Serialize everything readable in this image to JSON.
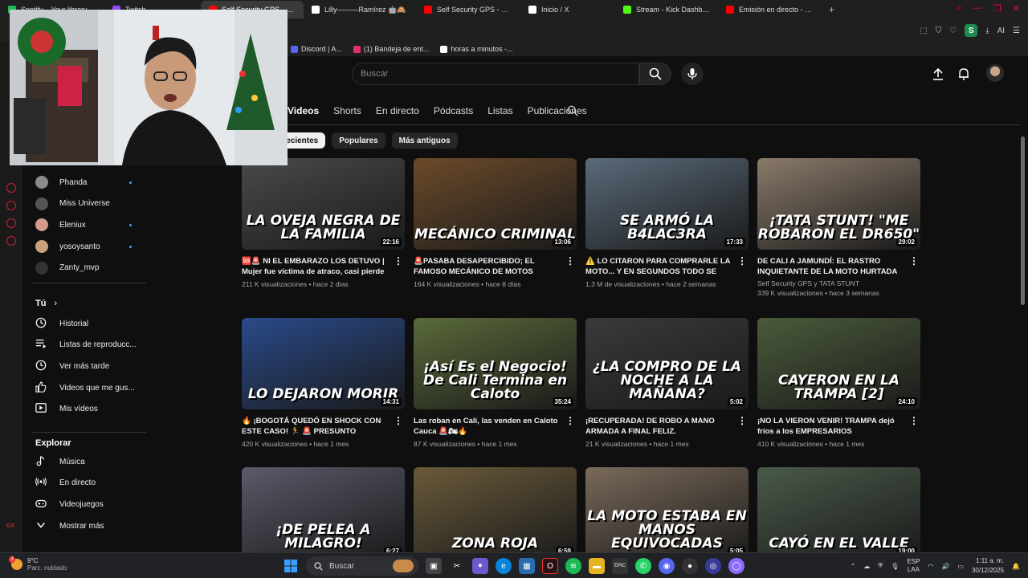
{
  "browser": {
    "tabs": [
      {
        "label": "Spotify – Your library",
        "color": "#1db954"
      },
      {
        "label": "Twitch",
        "color": "#9146ff"
      },
      {
        "label": "Self Security GPS - YouTu",
        "color": "#ff0000",
        "active": true
      },
      {
        "label": "Lilly———Ramírez 🤖🙈",
        "color": "#ffffff"
      },
      {
        "label": "Self Security GPS - YouTu",
        "color": "#ff0000"
      },
      {
        "label": "Inicio / X",
        "color": "#ffffff"
      },
      {
        "label": "Stream - Kick Dashboard",
        "color": "#53fc18"
      },
      {
        "label": "Emisión en directo - YouTu",
        "color": "#ff0000"
      }
    ],
    "profile_letter": "S",
    "ai_label": "AI",
    "bookmarks": [
      {
        "label": "Discord | A...",
        "color": "#5865f2"
      },
      {
        "label": "(1) Bandeja de ent...",
        "color": "#e1306c"
      },
      {
        "label": "horas a minutos -...",
        "color": "#ffffff"
      }
    ]
  },
  "header": {
    "search_placeholder": "Buscar"
  },
  "channel_tabs": [
    "Videos",
    "Shorts",
    "En directo",
    "Pódcasts",
    "Listas",
    "Publicaciones"
  ],
  "chips": [
    "Recientes",
    "Populares",
    "Más antiguos"
  ],
  "sidebar": {
    "subscriptions": [
      {
        "name": "Phanda",
        "live": true,
        "color": "#8a8a8a"
      },
      {
        "name": "Miss Universe",
        "live": false,
        "color": "#555555"
      },
      {
        "name": "Eleniux",
        "live": true,
        "color": "#d49a8a"
      },
      {
        "name": "yosoysanto",
        "live": true,
        "color": "#c9a27a"
      },
      {
        "name": "Zanty_mvp",
        "live": false,
        "color": "#333333"
      }
    ],
    "you_title": "Tú",
    "you_items": [
      "Historial",
      "Listas de reproducc...",
      "Ver más tarde",
      "Videos que me gus...",
      "Mis vídeos"
    ],
    "explore_title": "Explorar",
    "explore_items": [
      "Música",
      "En directo",
      "Videojuegos",
      "Mostrar más"
    ]
  },
  "videos": [
    {
      "thumb_text": "LA OVEJA NEGRA DE LA FAMILIA",
      "duration": "22:16",
      "title": "🆘🚨 NI EL EMBARAZO LOS DETUVO | Mujer fue víctima de atraco, casi pierde su...",
      "channel": "",
      "stats": "211 K visualizaciones • hace 2 días",
      "bg": "#4a4a4a"
    },
    {
      "thumb_text": "MECÁNICO CRIMINAL",
      "duration": "13:06",
      "title": "🚨PASABA DESAPERCIBIDO; EL FAMOSO MECÁNICO DE MOTOS ROBADAS LAS...",
      "channel": "",
      "stats": "164 K visualizaciones • hace 8 días",
      "bg": "#6b4a2a"
    },
    {
      "thumb_text": "SE ARMÓ LA B4LAC3RA",
      "duration": "17:33",
      "title": "⚠️ LO CITARON PARA COMPRARLE LA MOTO... Y EN SEGUNDOS TODO SE SALIÓ ...",
      "channel": "",
      "stats": "1,3 M de visualizaciones • hace 2 semanas",
      "bg": "#5a6a7a"
    },
    {
      "thumb_text": "¡TATA STUNT! \"ME ROBARON EL DR650\"",
      "duration": "29:02",
      "title": "DE CALI A JAMUNDÍ: EL RASTRO INQUIETANTE DE LA MOTO HURTADA DE...",
      "channel": "Self Security GPS y TATA STUNT",
      "stats": "339 K visualizaciones • hace 3 semanas",
      "bg": "#8a7a6a"
    },
    {
      "thumb_text": "LO DEJARON MORIR",
      "duration": "14:31",
      "title": "🔥 ¡BOGOTÁ QUEDÓ EN SHOCK CON ESTE CASO! 🏃 🚨 PRESUNTO LADRÓN...",
      "channel": "",
      "stats": "420 K visualizaciones • hace 1 mes",
      "bg": "#2a4a8a"
    },
    {
      "thumb_text": "¡Así Es el Negocio! De Cali Termina en Caloto",
      "duration": "35:24",
      "title": "Las roban en Cali, las venden en Caloto Cauca 🚨🏍🔥",
      "channel": "",
      "stats": "87 K visualizaciones • hace 1 mes",
      "bg": "#5a6a3a"
    },
    {
      "thumb_text": "¿LA COMPRO DE LA NOCHE A LA MAÑANA?",
      "duration": "5:02",
      "title": "¡RECUPERADA! DE ROBO A MANO ARMADA A FINAL FELIZ.",
      "channel": "",
      "stats": "21 K visualizaciones • hace 1 mes",
      "bg": "#3a3a3a"
    },
    {
      "thumb_text": "CAYERON EN LA TRAMPA [2]",
      "duration": "24:10",
      "title": "¡NO LA VIERON VENIR! TRAMPA dejó fríos a los EMPRESARIOS DELINCUENCIALES",
      "channel": "",
      "stats": "410 K visualizaciones • hace 1 mes",
      "bg": "#4a5a3a"
    },
    {
      "thumb_text": "¡DE PELEA A MILAGRO!",
      "duration": "6:27",
      "title": "",
      "channel": "",
      "stats": "",
      "bg": "#5a5a6a"
    },
    {
      "thumb_text": "ZONA ROJA",
      "duration": "6:59",
      "title": "",
      "channel": "",
      "stats": "",
      "bg": "#6a5a3a"
    },
    {
      "thumb_text": "LA MOTO ESTABA EN MANOS EQUIVOCADAS",
      "duration": "5:05",
      "title": "",
      "channel": "",
      "stats": "",
      "bg": "#7a6a5a"
    },
    {
      "thumb_text": "CAYÓ EN EL VALLE",
      "duration": "19:00",
      "title": "",
      "channel": "",
      "stats": "",
      "bg": "#4a5a4a"
    }
  ],
  "taskbar": {
    "weather_temp": "9°C",
    "weather_desc": "Parc. nublado",
    "weather_badge": "3",
    "search_label": "Buscar",
    "lang_line1": "ESP",
    "lang_line2": "LAA",
    "time": "1:11 a. m.",
    "date": "30/12/2025"
  }
}
